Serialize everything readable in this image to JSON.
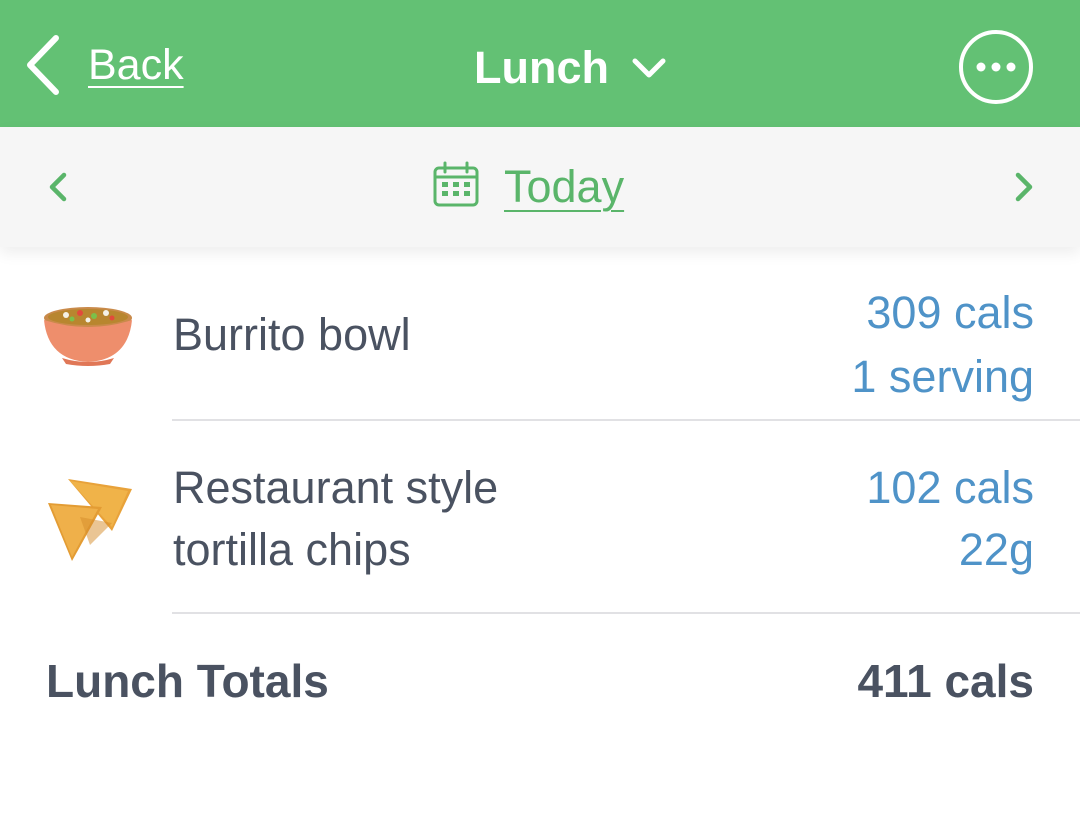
{
  "navbar": {
    "back_label": "Back",
    "title": "Lunch",
    "back_icon": "chevron-left-icon",
    "title_icon": "chevron-down-icon",
    "more_icon": "more-options-icon",
    "background_color": "#63c174"
  },
  "datebar": {
    "label": "Today",
    "calendar_icon": "calendar-icon",
    "prev_icon": "chevron-left-icon",
    "next_icon": "chevron-right-icon",
    "accent_color": "#5ab56a"
  },
  "foods": [
    {
      "name": "Burrito bowl",
      "calories": "309 cals",
      "amount": "1 serving",
      "icon": "burrito-bowl-icon"
    },
    {
      "name_line1": "Restaurant style",
      "name_line2": "tortilla chips",
      "calories": "102 cals",
      "amount": "22g",
      "icon": "tortilla-chips-icon"
    }
  ],
  "totals": {
    "label": "Lunch Totals",
    "value": "411 cals"
  }
}
